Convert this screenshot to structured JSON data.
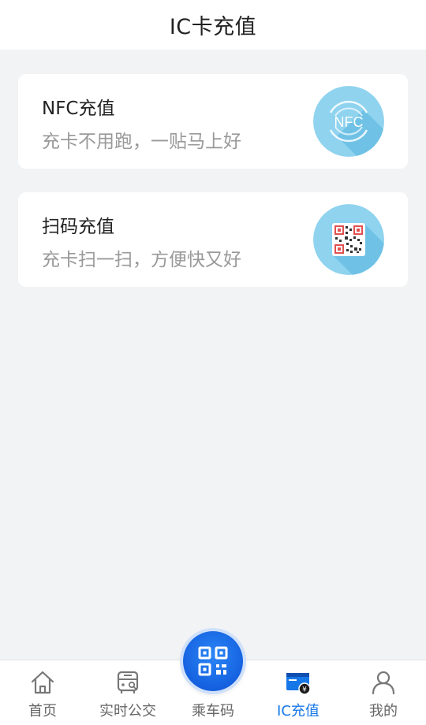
{
  "header": {
    "title": "IC卡充值"
  },
  "cards": {
    "nfc": {
      "title": "NFC充值",
      "subtitle": "充卡不用跑，一贴马上好",
      "icon": "nfc-icon",
      "icon_text": "NFC"
    },
    "qr": {
      "title": "扫码充值",
      "subtitle": "充卡扫一扫，方便快又好",
      "icon": "qr-code-icon"
    }
  },
  "tabbar": {
    "items": [
      {
        "label": "首页",
        "icon": "home-icon"
      },
      {
        "label": "实时公交",
        "icon": "bus-icon"
      },
      {
        "label": "乘车码",
        "icon": "qr-code-icon"
      },
      {
        "label": "IC充值",
        "icon": "card-recharge-icon",
        "active": true
      },
      {
        "label": "我的",
        "icon": "user-icon"
      }
    ]
  },
  "colors": {
    "accent": "#1677e8",
    "card_icon_bg": "#8fd3ef",
    "background": "#f2f3f5"
  }
}
